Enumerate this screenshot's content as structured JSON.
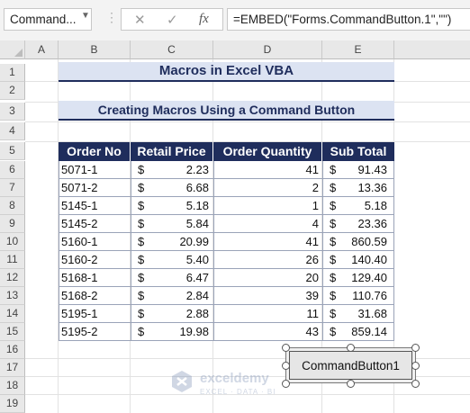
{
  "name_box": {
    "value": "Command..."
  },
  "formula_bar": {
    "cancel_icon": "✕",
    "enter_icon": "✓",
    "fx_label": "fx",
    "formula": "=EMBED(\"Forms.CommandButton.1\",\"\")"
  },
  "columns": [
    "A",
    "B",
    "C",
    "D",
    "E"
  ],
  "rows": [
    "1",
    "2",
    "3",
    "4",
    "5",
    "6",
    "7",
    "8",
    "9",
    "10",
    "11",
    "12",
    "13",
    "14",
    "15",
    "16",
    "17",
    "18",
    "19"
  ],
  "sheet": {
    "title": "Macros in Excel VBA",
    "subtitle": "Creating Macros Using a Command Button",
    "table": {
      "headers": [
        "Order No",
        "Retail Price",
        "Order Quantity",
        "Sub Total"
      ],
      "currency_symbol": "$",
      "rows": [
        {
          "order_no": "5071-1",
          "price": "2.23",
          "qty": "41",
          "subtotal": "91.43"
        },
        {
          "order_no": "5071-2",
          "price": "6.68",
          "qty": "2",
          "subtotal": "13.36"
        },
        {
          "order_no": "5145-1",
          "price": "5.18",
          "qty": "1",
          "subtotal": "5.18"
        },
        {
          "order_no": "5145-2",
          "price": "5.84",
          "qty": "4",
          "subtotal": "23.36"
        },
        {
          "order_no": "5160-1",
          "price": "20.99",
          "qty": "41",
          "subtotal": "860.59"
        },
        {
          "order_no": "5160-2",
          "price": "5.40",
          "qty": "26",
          "subtotal": "140.40"
        },
        {
          "order_no": "5168-1",
          "price": "6.47",
          "qty": "20",
          "subtotal": "129.40"
        },
        {
          "order_no": "5168-2",
          "price": "2.84",
          "qty": "39",
          "subtotal": "110.76"
        },
        {
          "order_no": "5195-1",
          "price": "2.88",
          "qty": "11",
          "subtotal": "31.68"
        },
        {
          "order_no": "5195-2",
          "price": "19.98",
          "qty": "43",
          "subtotal": "859.14"
        }
      ]
    }
  },
  "command_button": {
    "label": "CommandButton1"
  },
  "watermark": {
    "name": "exceldemy",
    "tagline": "EXCEL · DATA · BI"
  },
  "colors": {
    "header_fill": "#1f2d5c",
    "title_fill": "#dce3f2",
    "title_text": "#1f2d5c"
  }
}
